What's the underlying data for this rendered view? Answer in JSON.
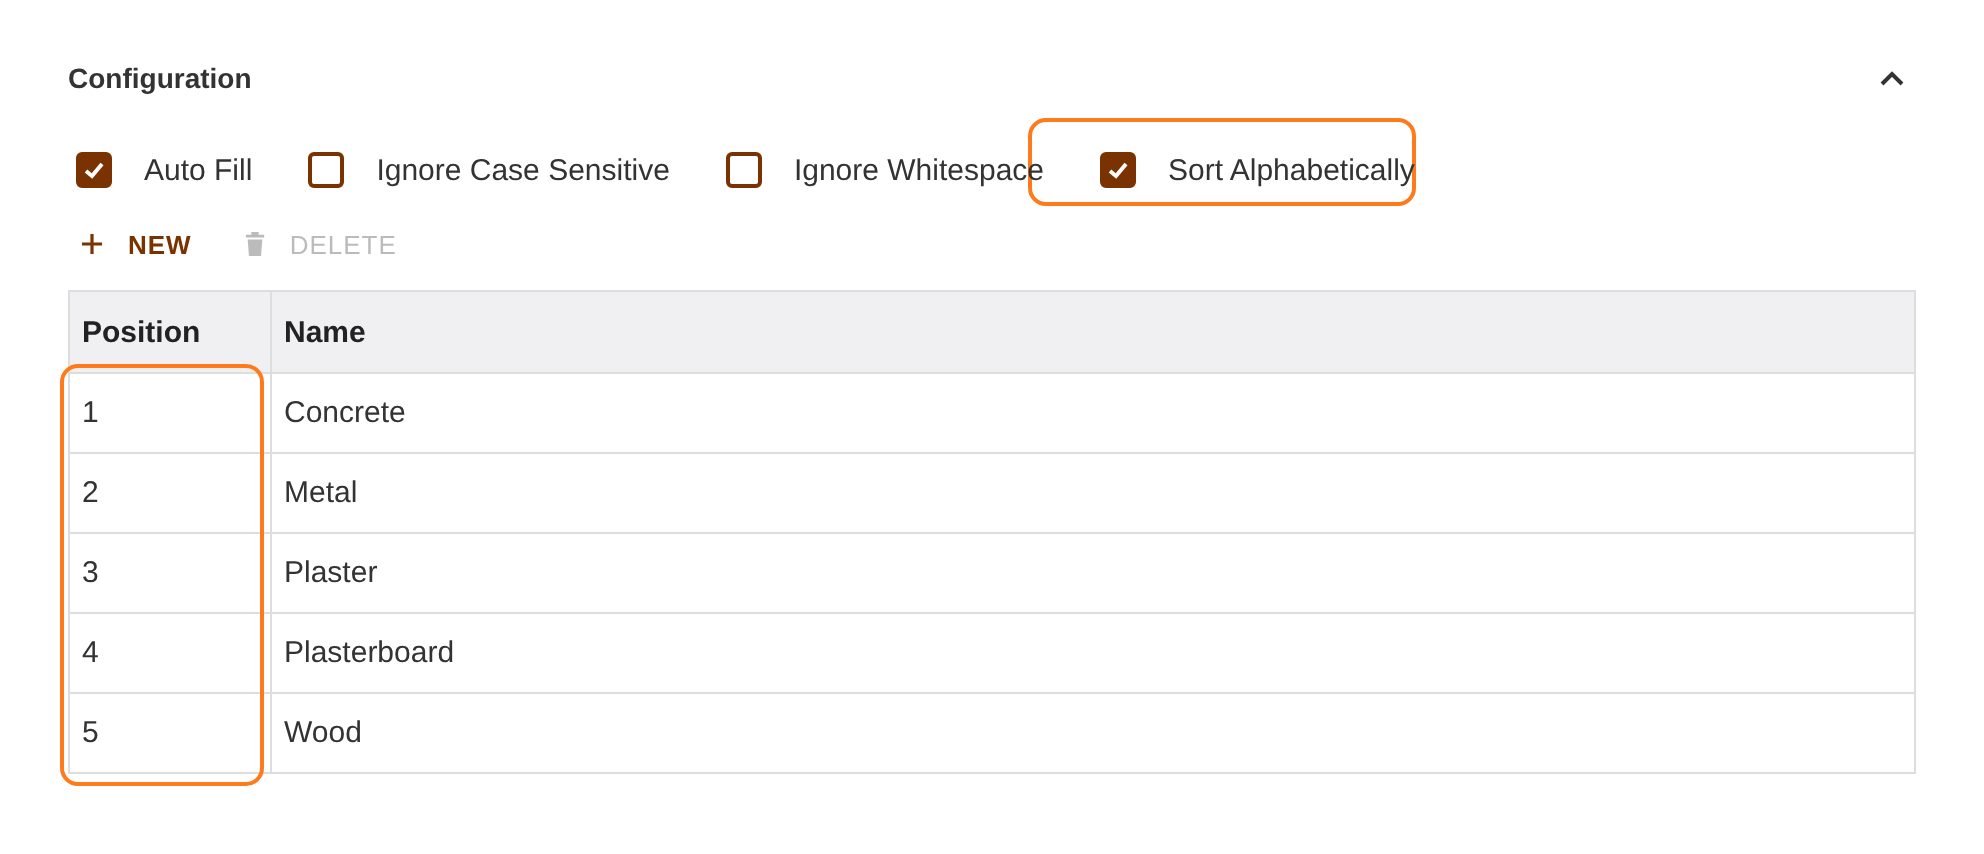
{
  "section": {
    "title": "Configuration",
    "expanded": true
  },
  "options": [
    {
      "label": "Auto Fill",
      "checked": true,
      "highlighted": false
    },
    {
      "label": "Ignore Case Sensitive",
      "checked": false,
      "highlighted": false
    },
    {
      "label": "Ignore Whitespace",
      "checked": false,
      "highlighted": false
    },
    {
      "label": "Sort Alphabetically",
      "checked": true,
      "highlighted": true
    }
  ],
  "actions": [
    {
      "kind": "new",
      "label": "NEW",
      "disabled": false
    },
    {
      "kind": "delete",
      "label": "DELETE",
      "disabled": true
    }
  ],
  "table": {
    "columns": [
      {
        "label": "Position",
        "highlighted": true
      },
      {
        "label": "Name",
        "highlighted": false
      }
    ],
    "rows": [
      [
        "1",
        "Concrete"
      ],
      [
        "2",
        "Metal"
      ],
      [
        "3",
        "Plaster"
      ],
      [
        "4",
        "Plasterboard"
      ],
      [
        "5",
        "Wood"
      ]
    ]
  }
}
